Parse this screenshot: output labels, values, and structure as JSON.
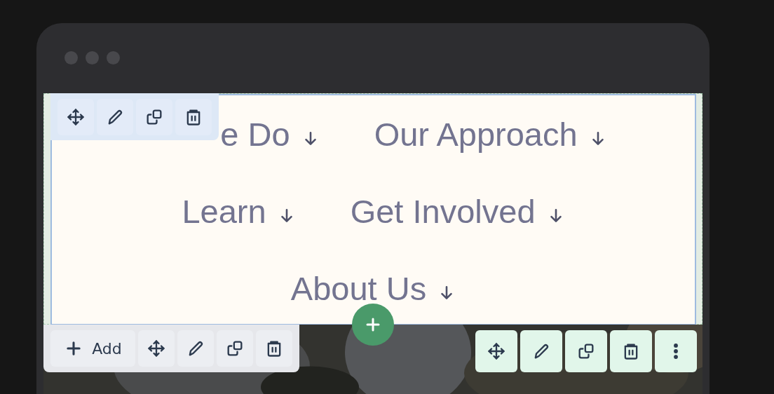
{
  "nav_block": {
    "items": [
      {
        "label": "e Do"
      },
      {
        "label": "Our Approach"
      },
      {
        "label": "Learn"
      },
      {
        "label": "Get Involved"
      },
      {
        "label": "About Us"
      }
    ]
  },
  "block_toolbar": {
    "buttons": [
      {
        "kind": "move"
      },
      {
        "kind": "edit"
      },
      {
        "kind": "duplicate"
      },
      {
        "kind": "delete"
      }
    ]
  },
  "section_toolbar": {
    "add_label": "Add",
    "buttons": [
      {
        "kind": "move"
      },
      {
        "kind": "edit"
      },
      {
        "kind": "duplicate"
      },
      {
        "kind": "delete"
      }
    ]
  },
  "hero_toolbar": {
    "buttons": [
      {
        "kind": "move"
      },
      {
        "kind": "edit"
      },
      {
        "kind": "duplicate"
      },
      {
        "kind": "delete"
      },
      {
        "kind": "more"
      }
    ]
  }
}
